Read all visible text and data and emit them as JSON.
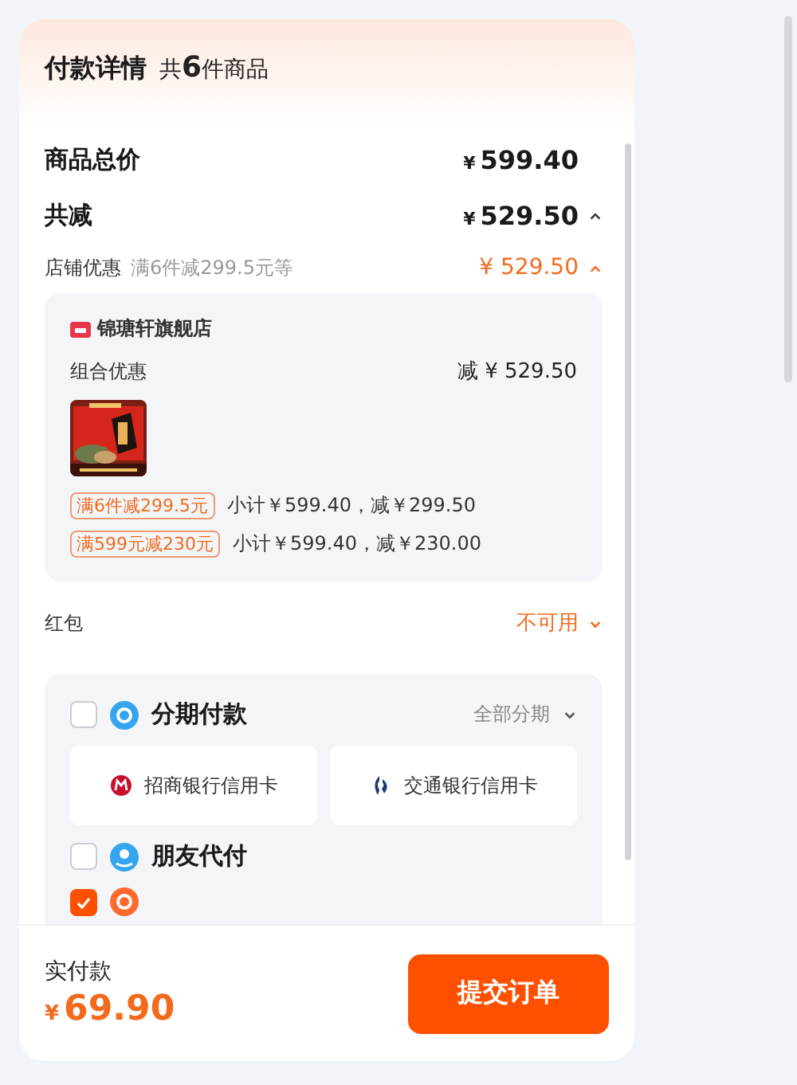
{
  "header": {
    "title": "付款详情",
    "count_prefix": "共",
    "count": "6",
    "count_suffix": "件商品"
  },
  "summary": [
    {
      "label": "商品总价",
      "currency": "¥",
      "amount": "599.40"
    },
    {
      "label": "共减",
      "currency": "¥",
      "amount": "529.50",
      "expanded": true
    }
  ],
  "store_discount": {
    "label": "店铺优惠",
    "note": "满6件减299.5元等",
    "amount": "¥ 529.50",
    "expanded": true
  },
  "store": {
    "name": "锦瑭轩旗舰店",
    "group_label": "组合优惠",
    "group_amount": "减 ¥ 529.50",
    "promos": [
      {
        "tag": "满6件减299.5元",
        "detail": "小计￥599.40，减￥299.50"
      },
      {
        "tag": "满599元减230元",
        "detail": "小计￥599.40，减￥230.00"
      }
    ]
  },
  "red_packet": {
    "label": "红包",
    "value": "不可用",
    "expanded": false
  },
  "payment": [
    {
      "kind": "installment",
      "label": "分期付款",
      "checked": false,
      "action": "全部分期",
      "expanded": false,
      "cards": [
        {
          "name": "招商银行信用卡"
        },
        {
          "name": "交通银行信用卡"
        }
      ]
    },
    {
      "kind": "friend",
      "label": "朋友代付",
      "checked": false
    },
    {
      "kind": "other",
      "checked": true
    }
  ],
  "footer": {
    "label": "实付款",
    "currency": "¥",
    "amount": "69.90",
    "button": "提交订单"
  }
}
